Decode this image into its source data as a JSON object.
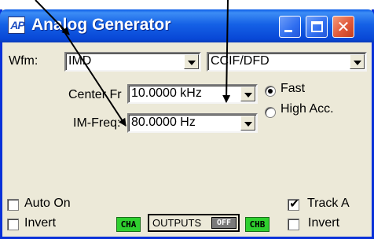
{
  "window": {
    "title": "Analog Generator",
    "icon_text": "AP",
    "controls": [
      "minimize-icon",
      "maximize-icon",
      "close-icon"
    ]
  },
  "waveform": {
    "label": "Wfm:",
    "type_value": "IMD",
    "standard_value": "CCIF/DFD"
  },
  "center_freq": {
    "label": "Center Fr",
    "value": "10.0000 kHz"
  },
  "im_freq": {
    "label": "IM-Freq:",
    "value": "80.0000  Hz"
  },
  "speed": {
    "fast_label": "Fast",
    "high_acc_label": "High Acc.",
    "selected": "Fast"
  },
  "outputs": {
    "auto_on_label": "Auto On",
    "auto_on_checked": false,
    "invert_a_label": "Invert",
    "invert_a_checked": false,
    "cha_label": "CHA",
    "outputs_label": "OUTPUTS",
    "outputs_state": "OFF",
    "chb_label": "CHB",
    "track_a_label": "Track A",
    "track_a_checked": true,
    "invert_b_label": "Invert",
    "invert_b_checked": false
  },
  "colors": {
    "title_bar": "#0a5be8",
    "window_bg": "#ece9d8",
    "channel_badge": "#2fd02f",
    "close_button": "#e0593a"
  }
}
